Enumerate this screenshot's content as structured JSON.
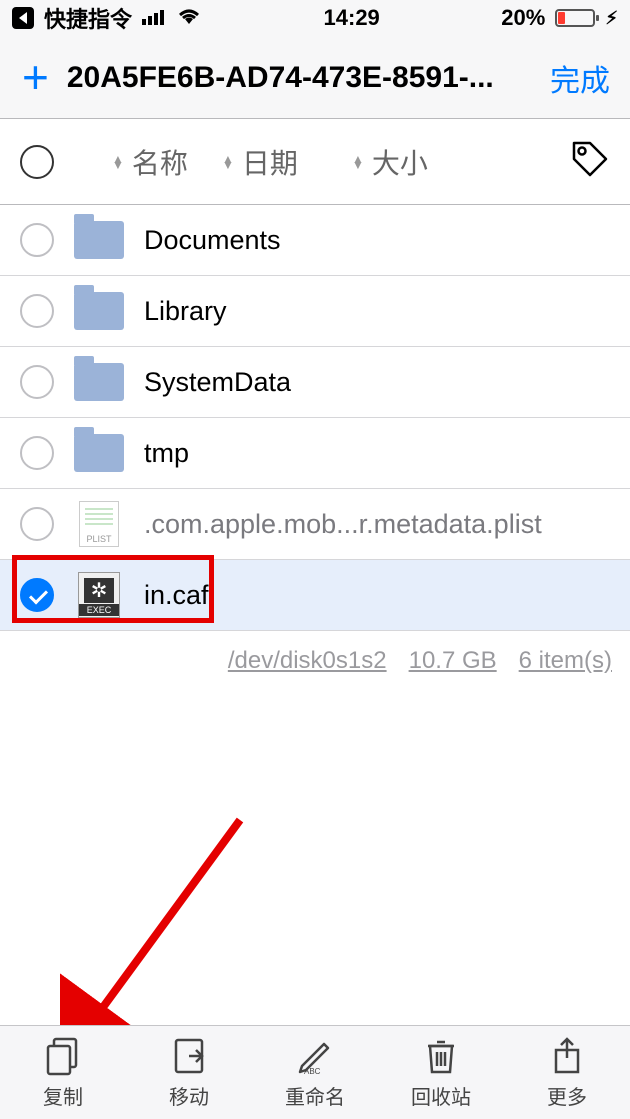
{
  "status": {
    "app_name": "快捷指令",
    "time": "14:29",
    "battery_pct": "20%"
  },
  "header": {
    "title": "20A5FE6B-AD74-473E-8591-...",
    "done": "完成"
  },
  "columns": {
    "name": "名称",
    "date": "日期",
    "size": "大小"
  },
  "items": [
    {
      "name": "Documents",
      "type": "folder",
      "selected": false
    },
    {
      "name": "Library",
      "type": "folder",
      "selected": false
    },
    {
      "name": "SystemData",
      "type": "folder",
      "selected": false
    },
    {
      "name": "tmp",
      "type": "folder",
      "selected": false
    },
    {
      "name": ".com.apple.mob...r.metadata.plist",
      "type": "plist",
      "selected": false
    },
    {
      "name": "in.caf",
      "type": "exec",
      "selected": true
    }
  ],
  "footer": {
    "path": "/dev/disk0s1s2",
    "space": "10.7 GB",
    "count": "6 item(s)"
  },
  "toolbar": {
    "copy": "复制",
    "move": "移动",
    "rename": "重命名",
    "trash": "回收站",
    "more": "更多"
  }
}
